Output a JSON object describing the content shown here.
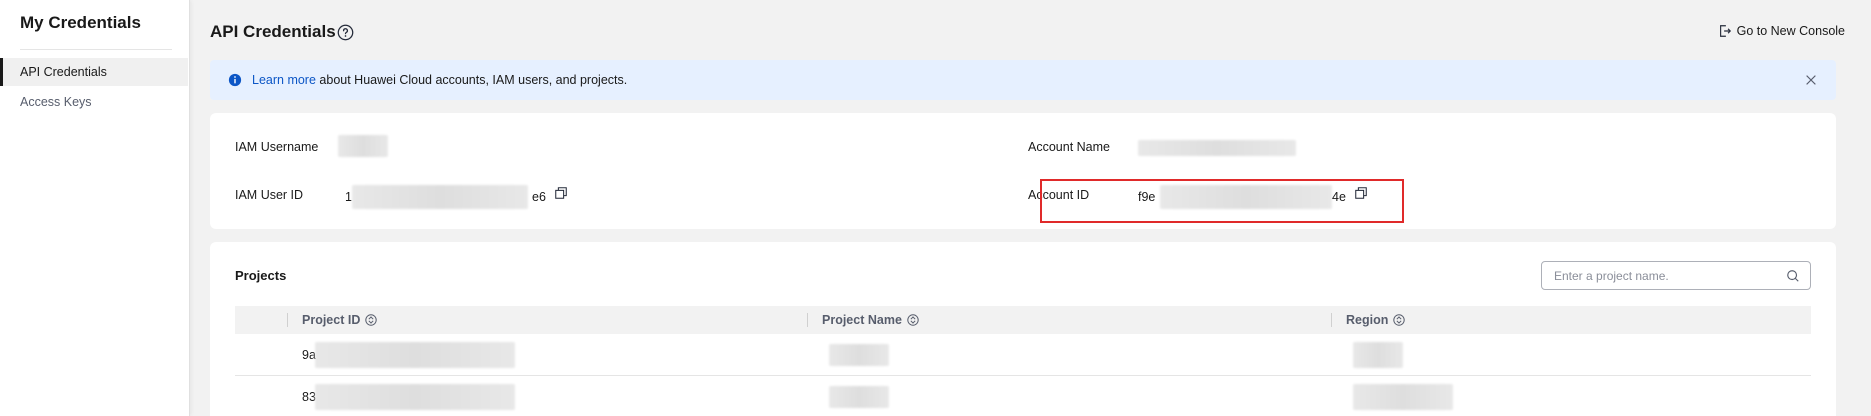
{
  "sidebar": {
    "title": "My Credentials",
    "items": [
      {
        "label": "API Credentials",
        "active": true
      },
      {
        "label": "Access Keys",
        "active": false
      }
    ]
  },
  "header": {
    "title": "API Credentials",
    "help_icon": "question-circle-icon",
    "go_console_label": "Go to New Console",
    "go_console_icon": "exit-icon"
  },
  "banner": {
    "link_text": "Learn more",
    "message": " about Huawei Cloud accounts, IAM users, and projects.",
    "info_icon": "info-circle-icon",
    "close_icon": "close-icon",
    "bg_color": "#e6f0ff",
    "link_color": "#0c56c6"
  },
  "credentials": {
    "iam_username_label": "IAM Username",
    "account_name_label": "Account Name",
    "iam_user_id_label": "IAM User ID",
    "iam_user_id_prefix": "1",
    "iam_user_id_suffix": "e6",
    "account_id_label": "Account ID",
    "account_id_prefix": "f9e",
    "account_id_suffix": "4e",
    "copy_icon": "copy-icon",
    "highlight_color": "#e02a2a"
  },
  "projects": {
    "title": "Projects",
    "search_placeholder": "Enter a project name.",
    "search_icon": "search-icon",
    "columns": [
      "Project ID",
      "Project Name",
      "Region"
    ],
    "sort_icon": "sort-icon",
    "rows": [
      {
        "project_id_prefix": "9a"
      },
      {
        "project_id_prefix": "83"
      }
    ]
  }
}
